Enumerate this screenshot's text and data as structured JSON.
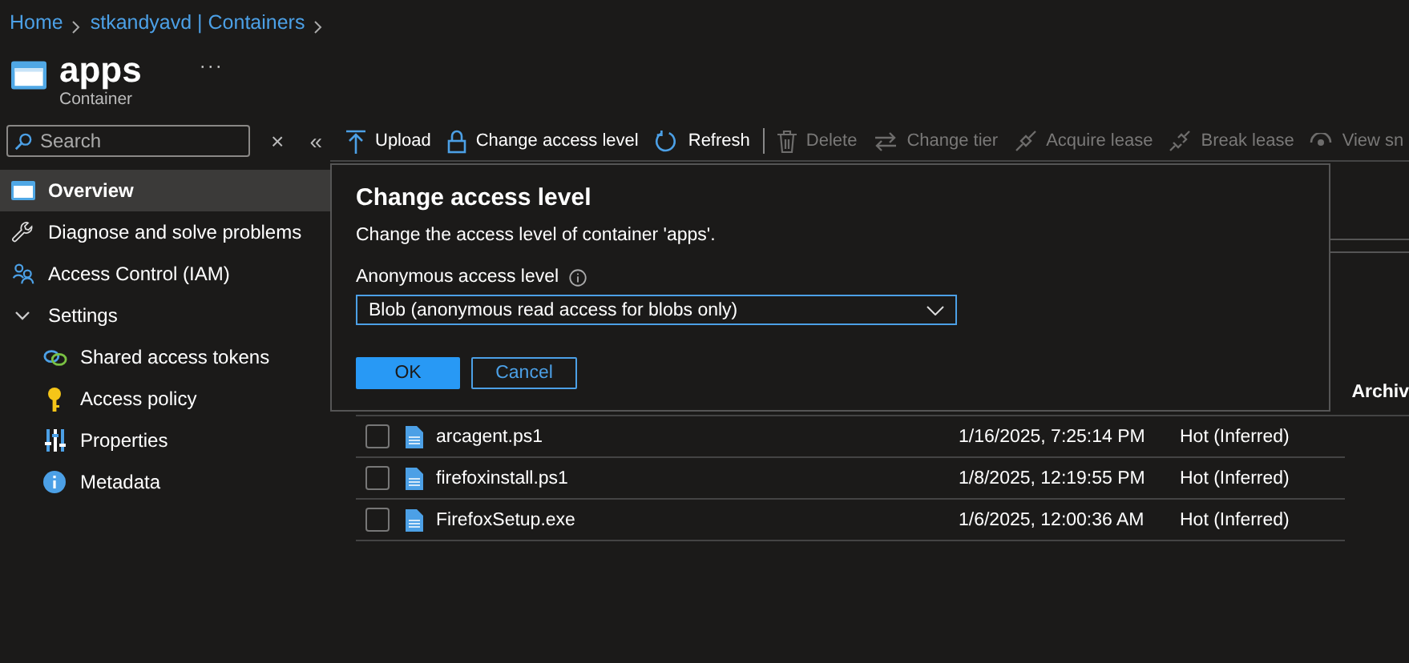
{
  "breadcrumb": [
    "Home",
    "stkandyavd | Containers"
  ],
  "header": {
    "title": "apps",
    "subtitle": "Container",
    "more": "···"
  },
  "sidebar": {
    "search": {
      "placeholder": "Search"
    },
    "close": "×",
    "collapse": "«",
    "items": [
      {
        "label": "Overview",
        "selected": true
      },
      {
        "label": "Diagnose and solve problems",
        "selected": false
      },
      {
        "label": "Access Control (IAM)",
        "selected": false
      },
      {
        "label": "Settings",
        "selected": false,
        "expanded": true,
        "children": [
          {
            "label": "Shared access tokens",
            "selected": false
          },
          {
            "label": "Access policy",
            "selected": false
          },
          {
            "label": "Properties",
            "selected": false
          },
          {
            "label": "Metadata",
            "selected": false
          }
        ]
      }
    ]
  },
  "toolbar": [
    {
      "label": "Upload",
      "disabled": false
    },
    {
      "label": "Change access level",
      "disabled": false
    },
    {
      "label": "Refresh",
      "disabled": false
    },
    {
      "label": "Delete",
      "disabled": true
    },
    {
      "label": "Change tier",
      "disabled": true
    },
    {
      "label": "Acquire lease",
      "disabled": true
    },
    {
      "label": "Break lease",
      "disabled": true
    },
    {
      "label": "View sn",
      "disabled": true
    }
  ],
  "dialog": {
    "title": "Change access level",
    "description": "Change the access level of container 'apps'.",
    "field_label": "Anonymous access level",
    "field_value": "Blob (anonymous read access for blobs only)",
    "buttons": [
      {
        "label": "OK",
        "kind": "primary"
      },
      {
        "label": "Cancel",
        "kind": "secondary"
      }
    ]
  },
  "table": {
    "column_header": "Archiv",
    "rows": [
      {
        "name": "arcagent.ps1",
        "modified": "1/16/2025, 7:25:14 PM",
        "tier": "Hot (Inferred)",
        "checked": false
      },
      {
        "name": "firefoxinstall.ps1",
        "modified": "1/8/2025, 12:19:55 PM",
        "tier": "Hot (Inferred)",
        "checked": false
      },
      {
        "name": "FirefoxSetup.exe",
        "modified": "1/6/2025, 12:00:36 AM",
        "tier": "Hot (Inferred)",
        "checked": false
      }
    ]
  }
}
